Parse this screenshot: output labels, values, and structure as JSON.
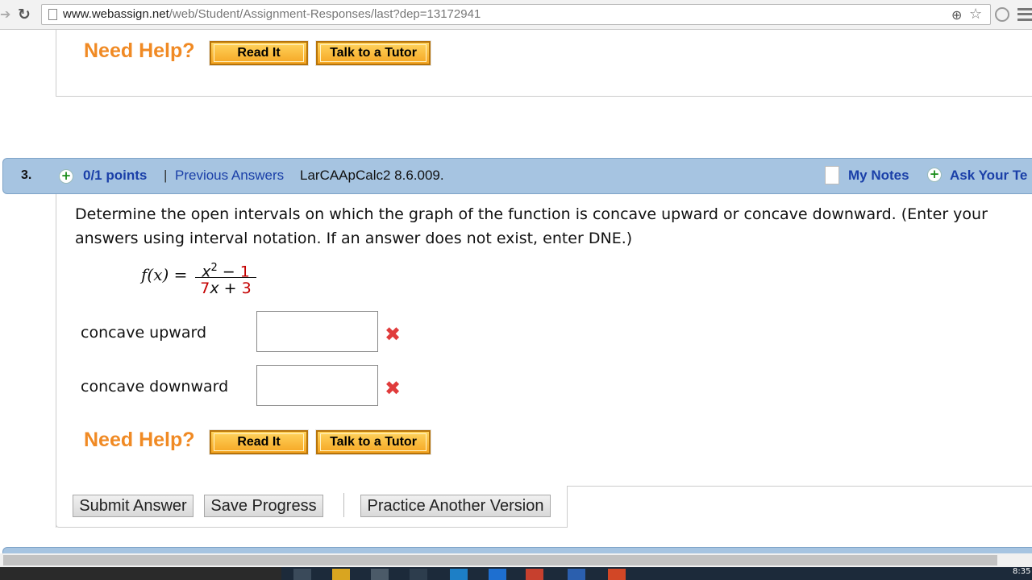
{
  "browser": {
    "url_host": "www.webassign.net",
    "url_path": "/web/Student/Assignment-Responses/last?dep=13172941"
  },
  "top_help": {
    "need_help": "Need Help?",
    "read_it": "Read It",
    "talk_tutor": "Talk to a Tutor"
  },
  "question": {
    "number": "3.",
    "points": "0/1 points",
    "separator": "|",
    "previous_answers": "Previous Answers",
    "reference": "LarCAApCalc2 8.6.009.",
    "my_notes": "My Notes",
    "ask_teacher": "Ask Your Te",
    "prompt": "Determine the open intervals on which the graph of the function is concave upward or concave downward. (Enter your answers using interval notation. If an answer does not exist, enter DNE.)",
    "function": {
      "lhs": "f(x) =",
      "num_var": "x",
      "num_exp": "2",
      "num_rest": " − ",
      "num_const": "1",
      "den_coef": "7",
      "den_var": "x",
      "den_op": " + ",
      "den_const": "3"
    },
    "answers": [
      {
        "label": "concave upward",
        "value": ""
      },
      {
        "label": "concave downward",
        "value": ""
      }
    ],
    "help": {
      "need_help": "Need Help?",
      "read_it": "Read It",
      "talk_tutor": "Talk to a Tutor"
    },
    "actions": {
      "submit": "Submit Answer",
      "save": "Save Progress",
      "practice": "Practice Another Version"
    }
  },
  "taskbar": {
    "clock": "8:35"
  }
}
